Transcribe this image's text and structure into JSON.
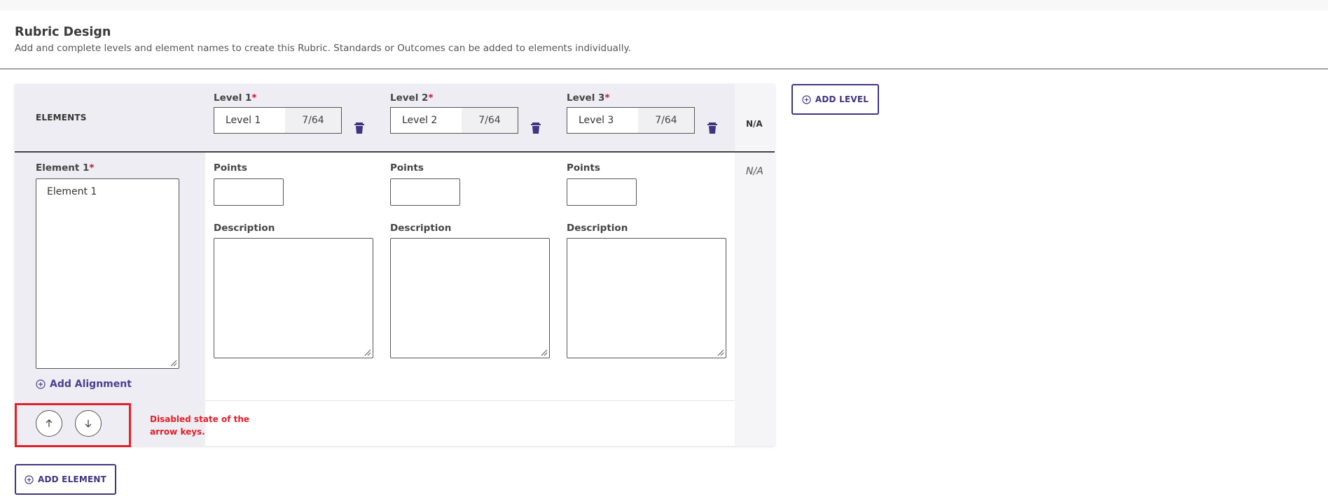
{
  "header": {
    "title": "Rubric Design",
    "subtitle": "Add and complete levels and element names to create this Rubric. Standards or Outcomes can be added to elements individually."
  },
  "table": {
    "elements_header": "ELEMENTS",
    "na_header": "N/A",
    "levels": [
      {
        "label": "Level 1",
        "required_mark": "*",
        "value": "Level 1",
        "count": "7/64"
      },
      {
        "label": "Level 2",
        "required_mark": "*",
        "value": "Level 2",
        "count": "7/64"
      },
      {
        "label": "Level 3",
        "required_mark": "*",
        "value": "Level 3",
        "count": "7/64"
      }
    ],
    "element": {
      "label": "Element 1",
      "required_mark": "*",
      "value": "Element 1",
      "add_alignment_label": "Add Alignment"
    },
    "cells": [
      {
        "points_label": "Points",
        "points_value": "",
        "description_label": "Description",
        "description_value": ""
      },
      {
        "points_label": "Points",
        "points_value": "",
        "description_label": "Description",
        "description_value": ""
      },
      {
        "points_label": "Points",
        "points_value": "",
        "description_label": "Description",
        "description_value": ""
      }
    ],
    "na_value": "N/A"
  },
  "annotation": {
    "note": "Disabled state of the arrow keys.",
    "color": "#e0202a"
  },
  "buttons": {
    "add_level": "ADD LEVEL",
    "add_element": "ADD ELEMENT",
    "move_up_icon": "arrow-up-icon",
    "move_down_icon": "arrow-down-icon"
  },
  "colors": {
    "accent": "#3f3580",
    "required": "#c8102e",
    "header_bg": "#eeedf3"
  }
}
